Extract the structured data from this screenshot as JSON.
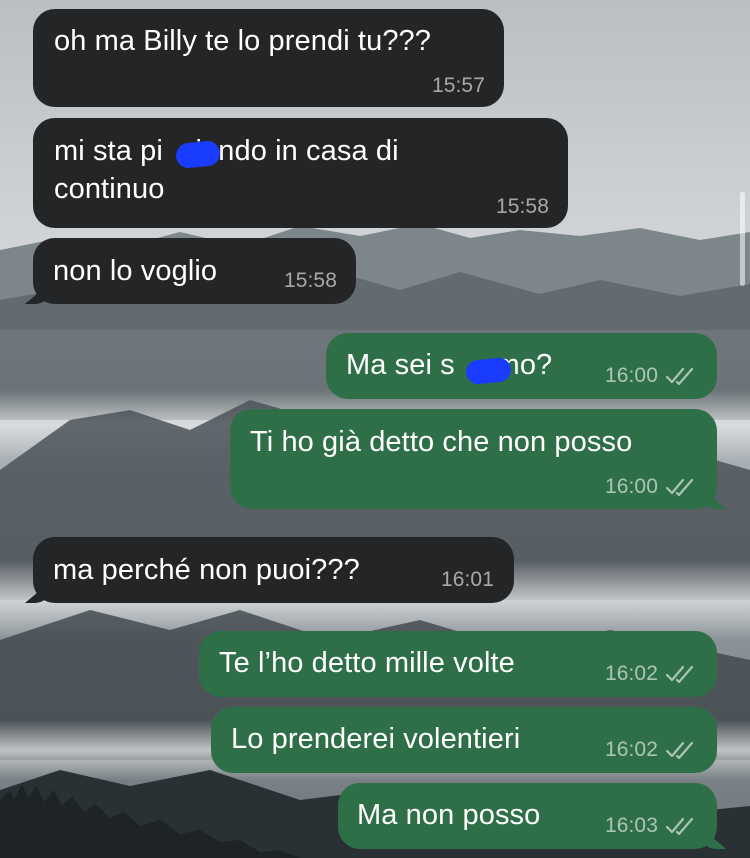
{
  "colors": {
    "incoming_bubble": "#232527",
    "outgoing_bubble": "#2f6f48",
    "text": "#ffffff",
    "redaction": "#1a3cff"
  },
  "wallpaper": "misty-mountains",
  "messages": [
    {
      "direction": "incoming",
      "text": "oh ma Billy te lo prendi tu???",
      "time": "15:57"
    },
    {
      "direction": "incoming",
      "text": "mi sta pi    iando in casa di\ncontinuo",
      "time": "15:58",
      "redacted": true
    },
    {
      "direction": "incoming",
      "text": "non lo voglio",
      "time": "15:58"
    },
    {
      "direction": "outgoing",
      "text": "Ma sei s     mo?",
      "time": "16:00",
      "status": "read-double-check",
      "redacted": true
    },
    {
      "direction": "outgoing",
      "text": "Ti ho già detto che non posso",
      "time": "16:00",
      "status": "read-double-check"
    },
    {
      "direction": "incoming",
      "text": "ma perché non puoi???",
      "time": "16:01"
    },
    {
      "direction": "outgoing",
      "text": "Te l’ho detto mille volte",
      "time": "16:02",
      "status": "read-double-check"
    },
    {
      "direction": "outgoing",
      "text": "Lo prenderei volentieri",
      "time": "16:02",
      "status": "read-double-check"
    },
    {
      "direction": "outgoing",
      "text": "Ma non posso",
      "time": "16:03",
      "status": "read-double-check"
    }
  ]
}
